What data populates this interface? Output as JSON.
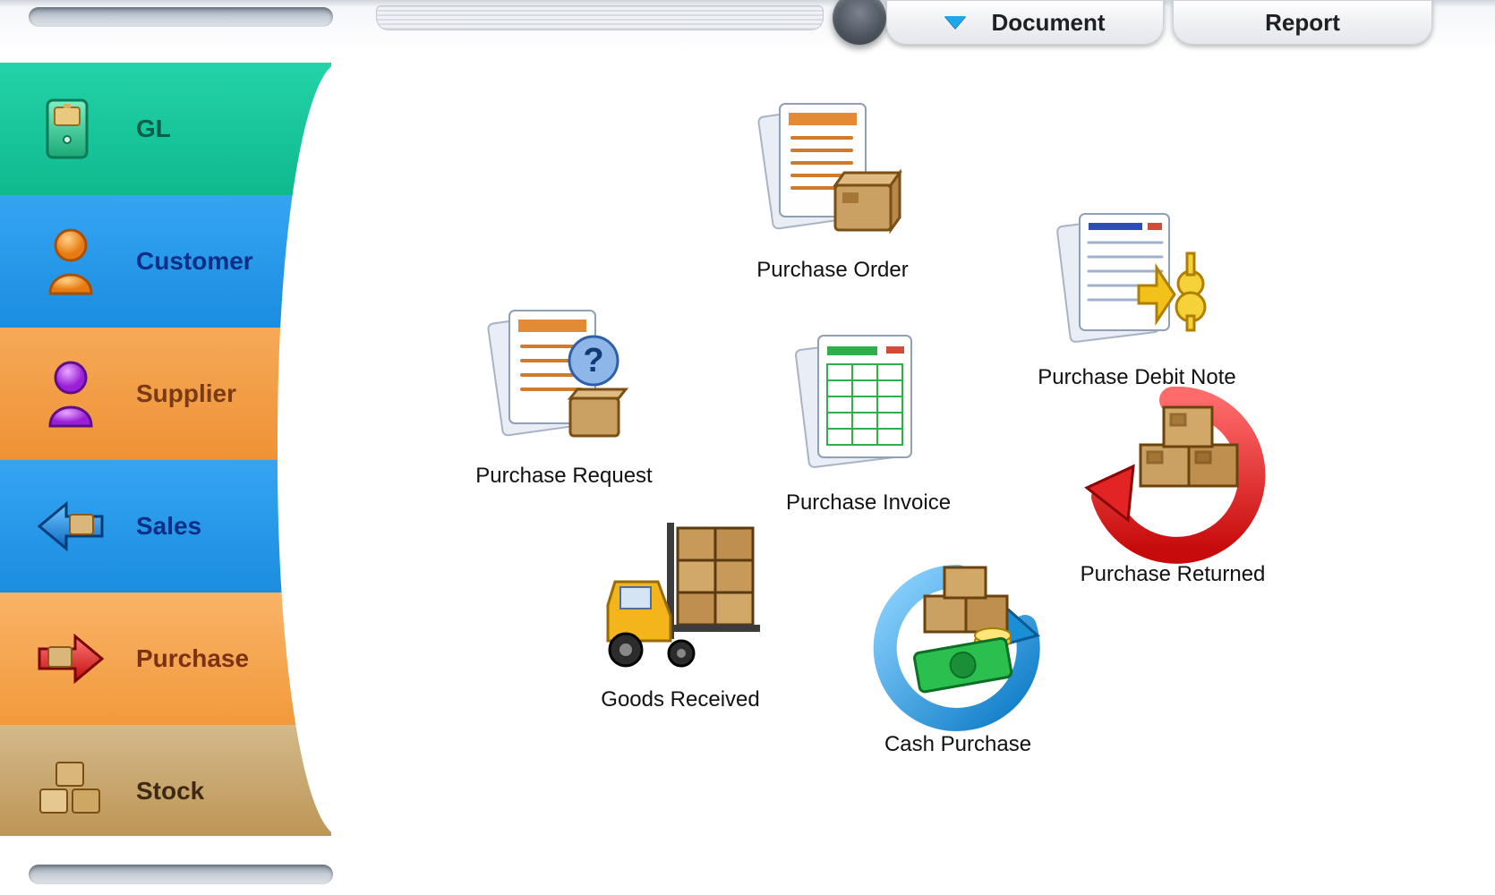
{
  "tabs": {
    "document": "Document",
    "report": "Report"
  },
  "sidebar": {
    "items": [
      {
        "id": "gl",
        "label": "GL"
      },
      {
        "id": "customer",
        "label": "Customer"
      },
      {
        "id": "supplier",
        "label": "Supplier"
      },
      {
        "id": "sales",
        "label": "Sales"
      },
      {
        "id": "purchase",
        "label": "Purchase",
        "active": true
      },
      {
        "id": "stock",
        "label": "Stock"
      }
    ]
  },
  "main": {
    "icons": [
      {
        "id": "purchase-order",
        "label": "Purchase Order"
      },
      {
        "id": "purchase-request",
        "label": "Purchase Request"
      },
      {
        "id": "purchase-invoice",
        "label": "Purchase Invoice"
      },
      {
        "id": "purchase-debit-note",
        "label": "Purchase Debit Note"
      },
      {
        "id": "goods-received",
        "label": "Goods Received"
      },
      {
        "id": "cash-purchase",
        "label": "Cash Purchase"
      },
      {
        "id": "purchase-returned",
        "label": "Purchase Returned"
      }
    ]
  }
}
